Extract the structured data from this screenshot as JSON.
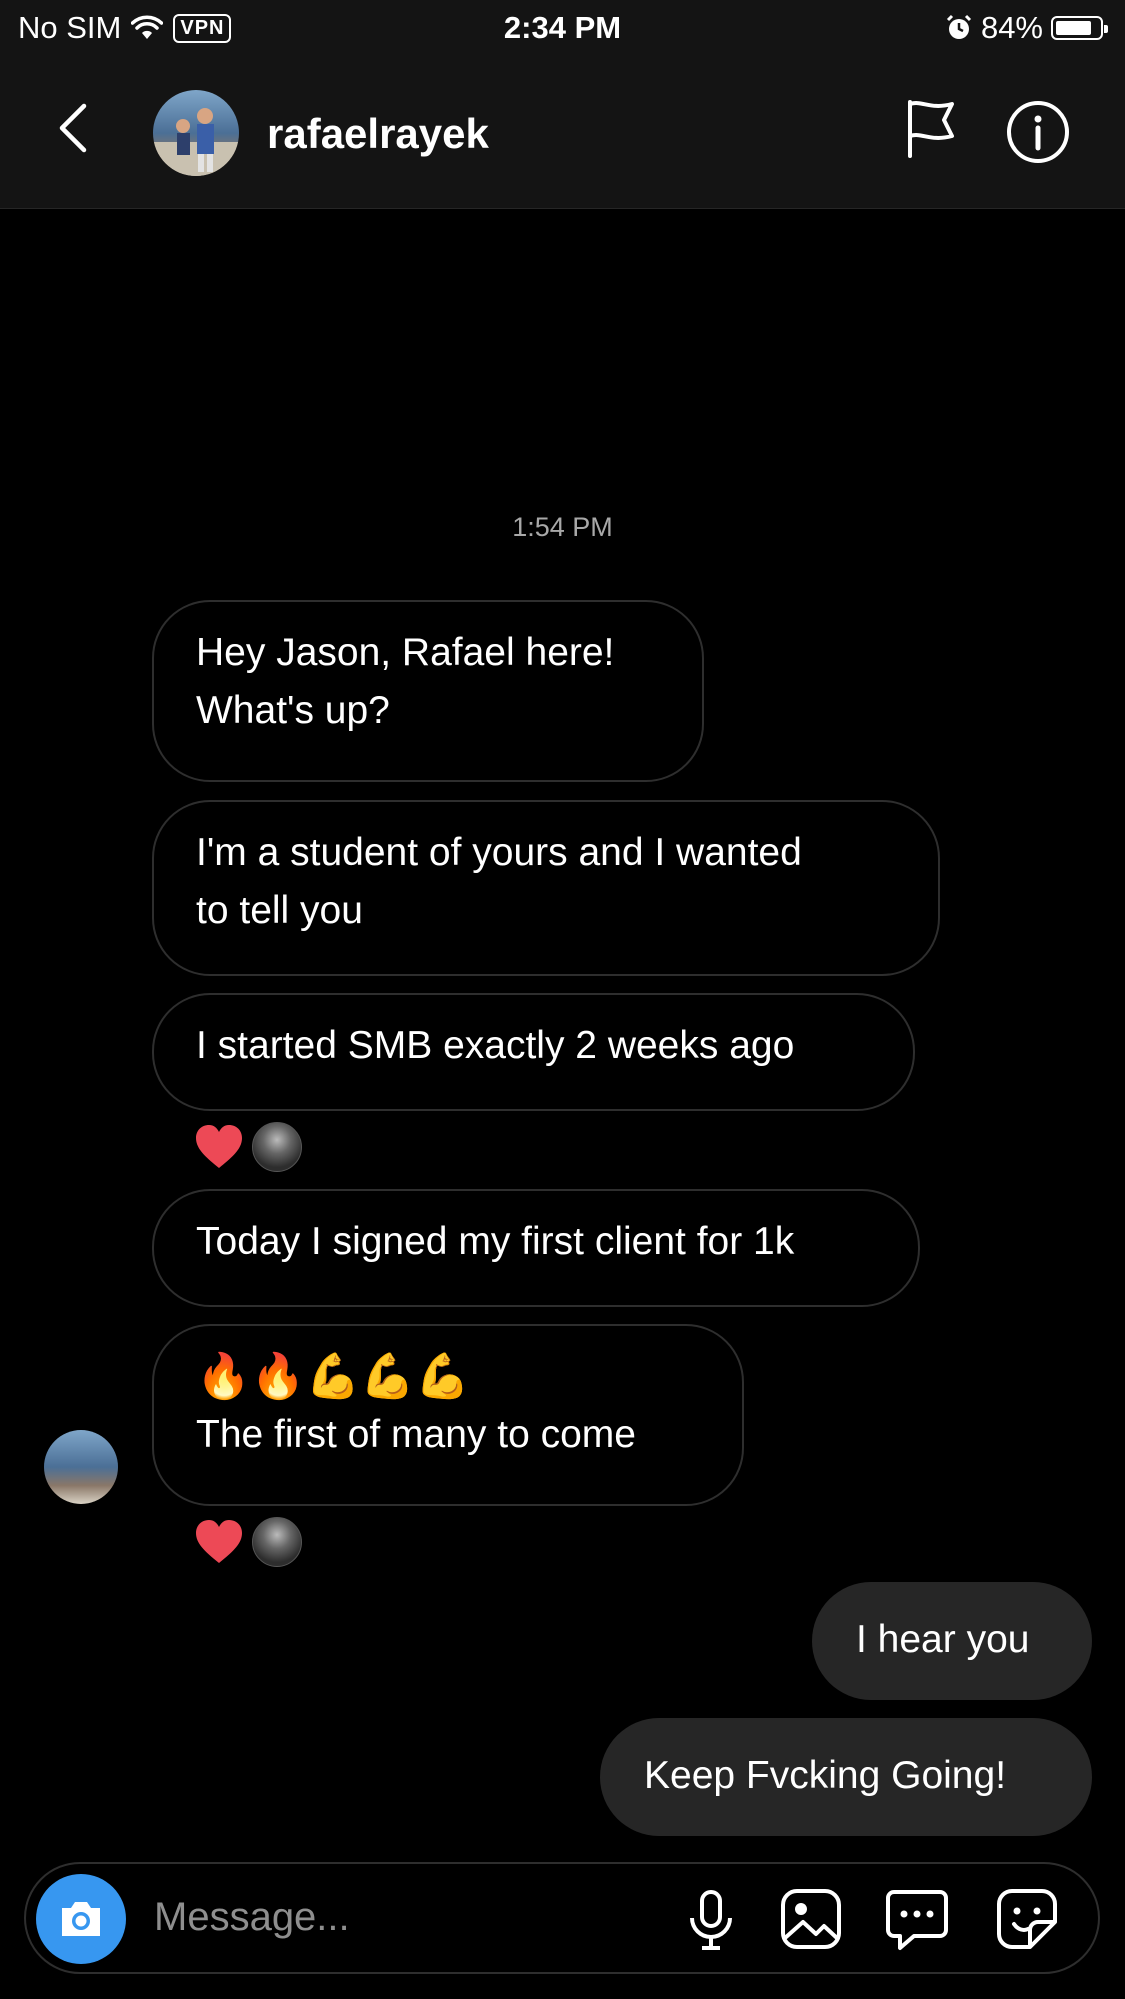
{
  "status_bar": {
    "carrier": "No SIM",
    "vpn_label": "VPN",
    "time": "2:34 PM",
    "battery": "84%",
    "battery_level": 0.84,
    "icons": [
      "wifi-icon",
      "alarm-icon",
      "battery-icon"
    ]
  },
  "header": {
    "username": "rafaelrayek",
    "icons": [
      "back-arrow-icon",
      "flag-icon",
      "info-icon"
    ]
  },
  "chat": {
    "timestamp": "1:54 PM",
    "incoming": [
      {
        "lines": [
          "Hey Jason, Rafael here!",
          "What's up?"
        ]
      },
      {
        "lines": [
          "I'm a student of yours and I wanted",
          "to tell you"
        ]
      },
      {
        "lines": [
          "I started SMB exactly 2 weeks ago"
        ],
        "reaction": "heart"
      },
      {
        "lines": [
          "Today I signed my first client for 1k"
        ]
      },
      {
        "lines": [
          "🔥🔥💪💪💪",
          "The first of many to come"
        ],
        "reaction": "heart"
      }
    ],
    "outgoing": [
      {
        "text": "I hear you"
      },
      {
        "text": "Keep Fvcking Going!"
      }
    ]
  },
  "composer": {
    "placeholder": "Message...",
    "icons": [
      "camera-icon",
      "microphone-icon",
      "gallery-icon",
      "chat-bubble-icon",
      "sticker-icon"
    ],
    "accent": "#3797f0"
  }
}
